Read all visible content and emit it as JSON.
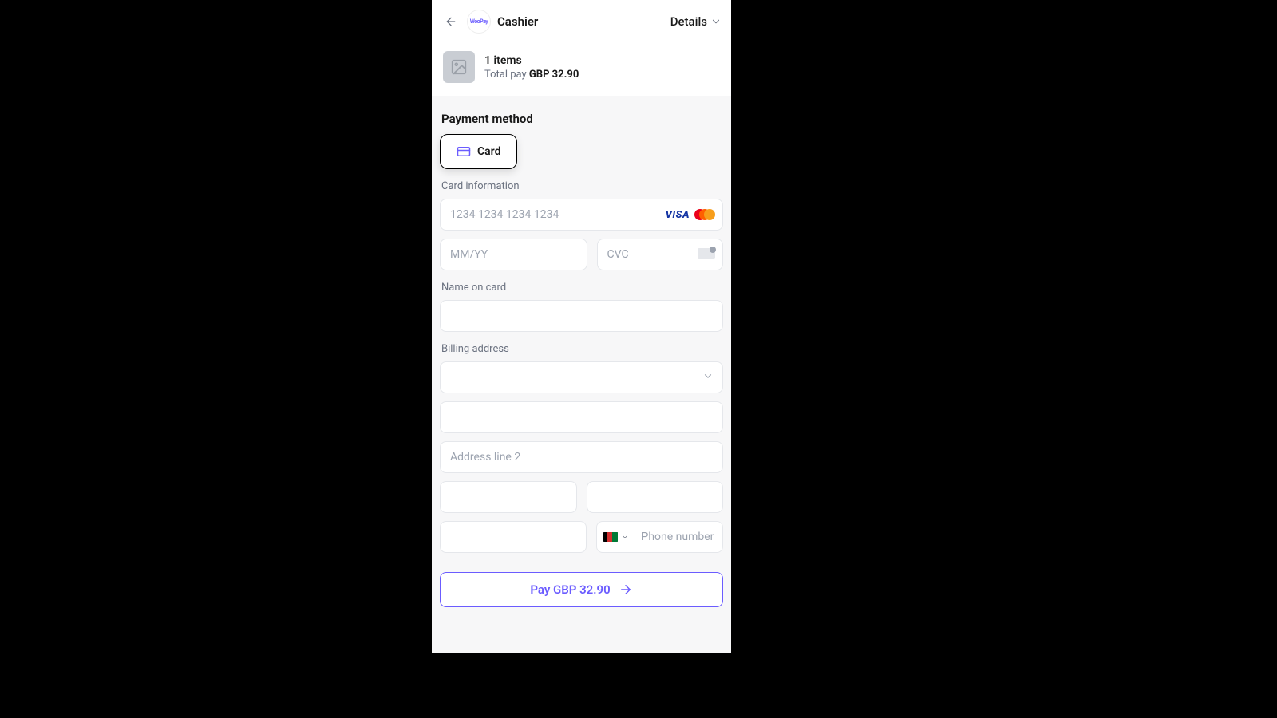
{
  "header": {
    "brand": "WooPay",
    "title": "Cashier",
    "details_label": "Details"
  },
  "order": {
    "items_line": "1 items",
    "total_prefix": "Total pay ",
    "total_amount": "GBP 32.90"
  },
  "payment_method": {
    "title": "Payment method",
    "card_label": "Card"
  },
  "card_info": {
    "label": "Card information",
    "number_placeholder": "1234 1234 1234 1234",
    "expiry_placeholder": "MM/YY",
    "cvc_placeholder": "CVC"
  },
  "name": {
    "label": "Name on card",
    "value": ""
  },
  "billing": {
    "label": "Billing address",
    "country_value": "",
    "line1_value": "",
    "line2_placeholder": "Address line 2",
    "city_value": "",
    "postcode_value": "",
    "state_value": "",
    "phone_placeholder": "Phone number"
  },
  "pay": {
    "label": "Pay GBP 32.90"
  }
}
